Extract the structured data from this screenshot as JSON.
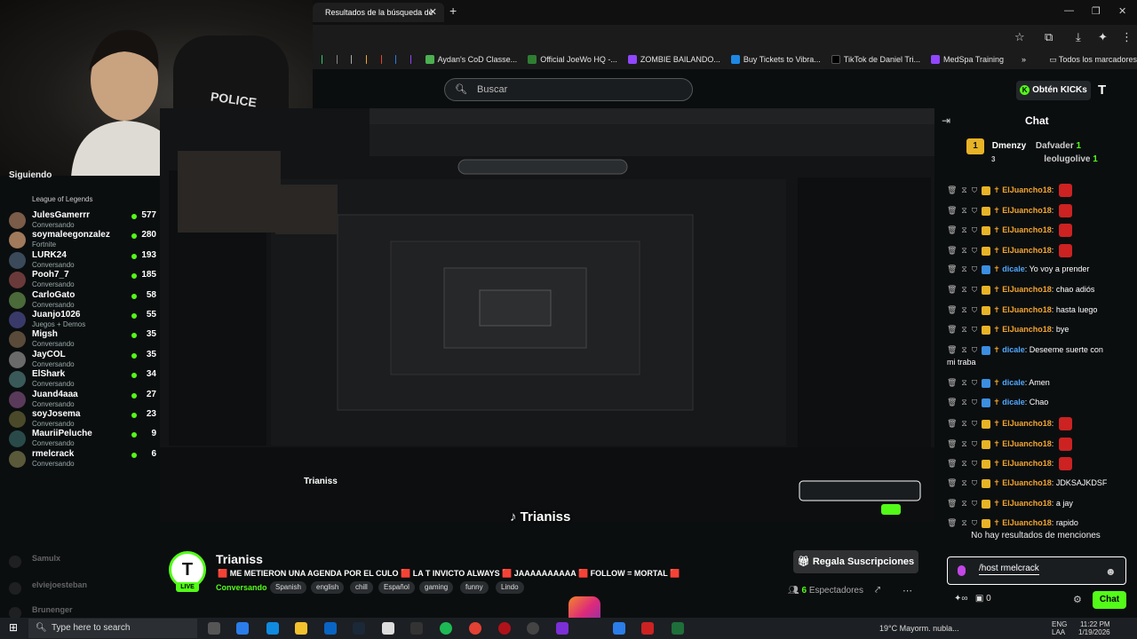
{
  "browser": {
    "tab_title": "Resultados de la búsqueda de",
    "bookmarks": [
      {
        "label": "Aydan's CoD Classe...",
        "color": "#4caf50"
      },
      {
        "label": "Official JoeWo HQ -...",
        "color": "#2e7d32"
      },
      {
        "label": "ZOMBIE BAILANDO...",
        "color": "#9146ff"
      },
      {
        "label": "Buy Tickets to Vibra...",
        "color": "#1e88e5"
      },
      {
        "label": "TikTok de Daniel Tri...",
        "color": "#000000"
      },
      {
        "label": "MedSpa Training",
        "color": "#9146ff"
      }
    ],
    "all_bookmarks": "Todos los marcadores"
  },
  "header": {
    "search_placeholder": "Buscar",
    "kicks_button": "Obtén KICKs",
    "brand_icon": "kick-logo"
  },
  "webcam": {
    "chair_text": "POLICE"
  },
  "sidebar": {
    "section": "Siguiendo",
    "channels": [
      {
        "name": "",
        "category": "League of Legends",
        "count": ""
      },
      {
        "name": "JulesGamerrr",
        "category": "Conversando",
        "count": "577"
      },
      {
        "name": "soymaleegonzalez",
        "category": "Fortnite",
        "count": "280"
      },
      {
        "name": "LURK24",
        "category": "Conversando",
        "count": "193"
      },
      {
        "name": "Pooh7_7",
        "category": "Conversando",
        "count": "185"
      },
      {
        "name": "CarloGato",
        "category": "Conversando",
        "count": "58"
      },
      {
        "name": "Juanjo1026",
        "category": "Juegos + Demos",
        "count": "55"
      },
      {
        "name": "Migsh",
        "category": "Conversando",
        "count": "35"
      },
      {
        "name": "JayCOL",
        "category": "Conversando",
        "count": "35"
      },
      {
        "name": "ElShark",
        "category": "Conversando",
        "count": "34"
      },
      {
        "name": "Juand4aaa",
        "category": "Conversando",
        "count": "27"
      },
      {
        "name": "soyJosema",
        "category": "Conversando",
        "count": "23"
      },
      {
        "name": "MauriiPeluche",
        "category": "Conversando",
        "count": "9"
      },
      {
        "name": "rmelcrack",
        "category": "Conversando",
        "count": "6"
      }
    ],
    "offline": [
      "Samulx",
      "elviejoesteban",
      "Brunenger"
    ]
  },
  "stream": {
    "streamer": "Trianiss",
    "overlay_name": "Trianiss",
    "live": "LIVE",
    "title": "🟥 ME METIERON UNA AGENDA POR EL CULO 🟥 LA T INVICTO ALWAYS 🟥 JAAAAAAAAAA 🟥 FOLLOW = MORTAL 🟥",
    "category": "Conversando",
    "tags": [
      "Spanish",
      "english",
      "chill",
      "Español",
      "gaming",
      "funny",
      "Lindo"
    ],
    "subs_button": "Regala Suscripciones",
    "viewers": "6",
    "viewers_label": "Espectadores"
  },
  "chat": {
    "title": "Chat",
    "top_gifters": {
      "rank": "1",
      "user1": "Dmenzy",
      "count1": "3",
      "user2": "Dafvader",
      "count2": "1",
      "user3": "leolugolive",
      "count3": "1"
    },
    "messages": [
      {
        "user": "ElJuancho18",
        "text": "",
        "color": "orange",
        "emote": true
      },
      {
        "user": "ElJuancho18",
        "text": "",
        "color": "orange",
        "emote": true
      },
      {
        "user": "ElJuancho18",
        "text": "",
        "color": "orange",
        "emote": true
      },
      {
        "user": "ElJuancho18",
        "text": "",
        "color": "orange",
        "emote": true
      },
      {
        "user": "dicale",
        "text": "Yo voy a prender",
        "color": "blue",
        "emote": false
      },
      {
        "user": "ElJuancho18",
        "text": "chao adiós",
        "color": "orange",
        "emote": false
      },
      {
        "user": "ElJuancho18",
        "text": "hasta luego",
        "color": "orange",
        "emote": false
      },
      {
        "user": "ElJuancho18",
        "text": "bye",
        "color": "orange",
        "emote": false
      },
      {
        "user": "dicale",
        "text": "Deseeme suerte con",
        "color": "blue",
        "emote": false
      },
      {
        "user": "",
        "text": "mi traba",
        "color": "none",
        "emote": false
      },
      {
        "user": "dicale",
        "text": "Amen",
        "color": "blue",
        "emote": false
      },
      {
        "user": "dicale",
        "text": "Chao",
        "color": "blue",
        "emote": false
      },
      {
        "user": "ElJuancho18",
        "text": "",
        "color": "orange",
        "emote": true
      },
      {
        "user": "ElJuancho18",
        "text": "",
        "color": "orange",
        "emote": true
      },
      {
        "user": "ElJuancho18",
        "text": "",
        "color": "orange",
        "emote": true
      },
      {
        "user": "ElJuancho18",
        "text": "JDKSAJKDSF",
        "color": "orange",
        "emote": false
      },
      {
        "user": "ElJuancho18",
        "text": "a jay",
        "color": "orange",
        "emote": false
      },
      {
        "user": "ElJuancho18",
        "text": "rapido",
        "color": "orange",
        "emote": false
      }
    ],
    "no_mentions": "No hay resultados de menciones",
    "input_value": "/host rmelcrack",
    "send_label": "Chat",
    "kicks_balance": "0"
  },
  "taskbar": {
    "search_placeholder": "Type here to search",
    "weather": "19°C Mayorm. nubla...",
    "lang": "ENG",
    "region": "LAA",
    "time": "11:22 PM",
    "date": "1/19/2026"
  },
  "colors": {
    "accent": "#53fc18",
    "bg": "#0b0e0f",
    "username_orange": "#f4a531",
    "username_blue": "#4fa9ff"
  }
}
